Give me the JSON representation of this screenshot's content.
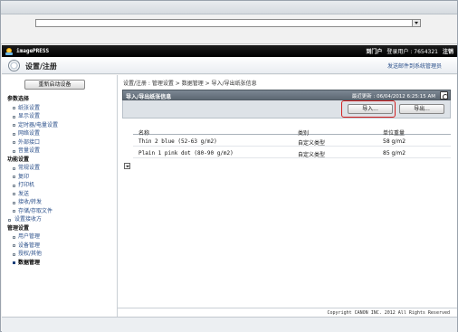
{
  "header": {
    "brand": "imagePRESS",
    "portal_link": "到门户",
    "login_label": "登录用户",
    "user_id": "7654321",
    "logout_link": "注销"
  },
  "module": {
    "title": "设置/注册",
    "email_link": "发送邮件到系统管理员"
  },
  "sidebar": {
    "restart_button": "重新启动设备",
    "sections": [
      {
        "label": "参数选择",
        "items": [
          "纸张设置",
          "显示设置",
          "定时器/电量设置",
          "网络设置",
          "外部接口",
          "音量设置"
        ]
      },
      {
        "label": "功能设置",
        "items": [
          "常规设置",
          "复印",
          "打印机",
          "发送",
          "接收/转发",
          "存储/存取文件"
        ]
      }
    ],
    "standalone_item": "设置接收方",
    "management": {
      "label": "管理设置",
      "items": [
        "用户管理",
        "设备管理",
        "授权/其他",
        "数据管理"
      ]
    },
    "active_item": "数据管理"
  },
  "content": {
    "breadcrumb": "设置/注册 : 管理设置 > 数据管理 > 导入/导出纸张信息",
    "panel_title": "导入/导出纸张信息",
    "last_updated": "最近更新 : 06/04/2012 6:25:15 AM",
    "import_button": "导入...",
    "export_button": "导出...",
    "table": {
      "headers": [
        "名称",
        "类别",
        "单位重量"
      ],
      "rows": [
        [
          "Thin 2 blue (52-63 g/m2)",
          "自定义类型",
          "58 g/m2"
        ],
        [
          "Plain 1 pink dot (80-90 g/m2)",
          "自定义类型",
          "85 g/m2"
        ]
      ]
    }
  },
  "footer": {
    "copyright": "Copyright CANON INC. 2012 All Rights Reserved"
  },
  "colors": {
    "appbar": "#000000",
    "panel_header": "#6b7681",
    "highlight_ring": "#d42020",
    "link": "#2a4f8a"
  }
}
